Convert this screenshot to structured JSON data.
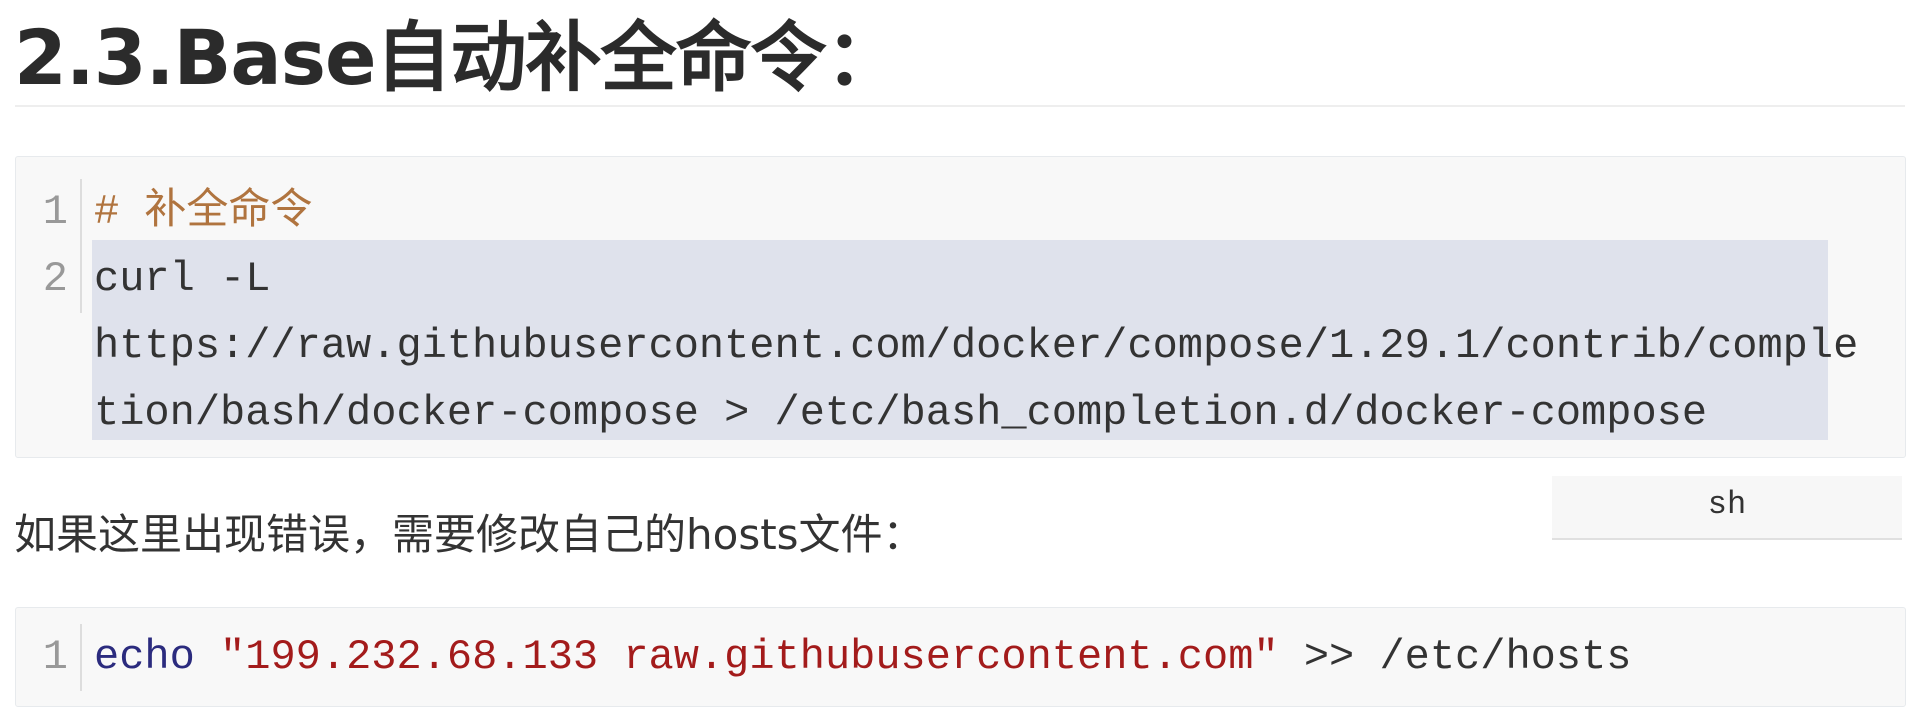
{
  "heading": "2.3.Base自动补全命令：",
  "code_block_1": {
    "line_numbers": [
      "1",
      "2"
    ],
    "comment": "# 补全命令",
    "lines": [
      "curl -L",
      "https://raw.githubusercontent.com/docker/compose/1.29.1/contrib/comple",
      "tion/bash/docker-compose > /etc/bash_completion.d/docker-compose"
    ],
    "language": "sh"
  },
  "paragraph": "如果这里出现错误，需要修改自己的hosts文件：",
  "code_block_2": {
    "line_numbers": [
      "1"
    ],
    "keyword": "echo",
    "string": "\"199.232.68.133 raw.githubusercontent.com\"",
    "rest": " >> /etc/hosts"
  },
  "colors": {
    "comment": "#b0743f",
    "keyword": "#2b2b7e",
    "string": "#a31b1b",
    "selection": "#dfe2ec"
  }
}
